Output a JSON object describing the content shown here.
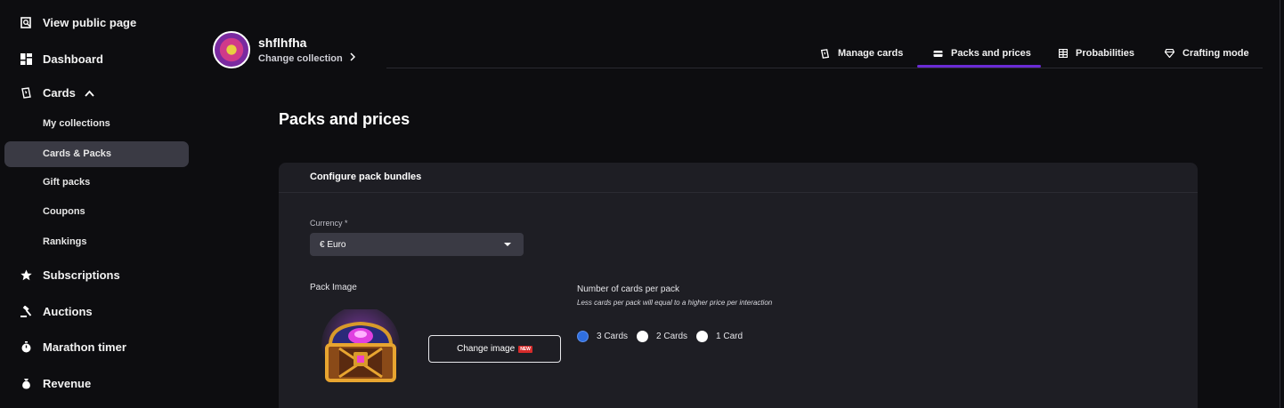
{
  "sidebar": {
    "view_public": "View public page",
    "dashboard": "Dashboard",
    "cards": "Cards",
    "cards_sub": [
      "My collections",
      "Cards & Packs",
      "Gift packs",
      "Coupons",
      "Rankings"
    ],
    "subscriptions": "Subscriptions",
    "auctions": "Auctions",
    "marathon": "Marathon timer",
    "revenue": "Revenue",
    "active_sub": "Cards & Packs"
  },
  "header": {
    "collection_name": "shflhfha",
    "change_collection": "Change collection"
  },
  "tabs": [
    {
      "label": "Manage cards",
      "icon": "card-icon"
    },
    {
      "label": "Packs and prices",
      "icon": "pack-icon"
    },
    {
      "label": "Probabilities",
      "icon": "table-icon"
    },
    {
      "label": "Crafting mode",
      "icon": "gem-icon"
    }
  ],
  "active_tab": "Packs and prices",
  "main": {
    "title": "Packs and prices",
    "section_title": "Configure pack bundles",
    "currency_label": "Currency *",
    "currency_value": "€ Euro",
    "pack_image_label": "Pack Image",
    "change_image": "Change image",
    "new_badge": "NEW",
    "cards_per_pack_label": "Number of cards per pack",
    "cards_per_pack_hint": "Less cards per pack will equal to a higher price per interaction",
    "options": [
      "3 Cards",
      "2 Cards",
      "1 Card"
    ],
    "selected_option": "3 Cards"
  },
  "colors": {
    "accent": "#6a2bd4",
    "radio_selected": "#2f6fe0",
    "badge": "#d62b2b"
  }
}
